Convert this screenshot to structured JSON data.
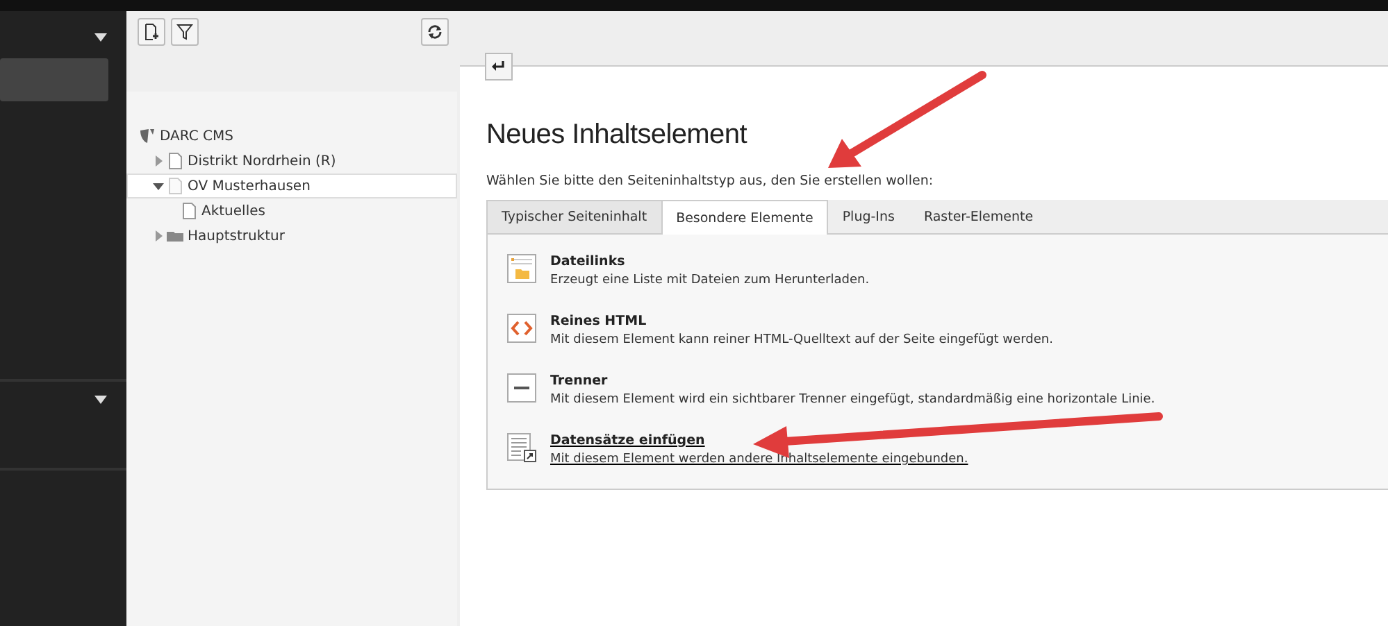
{
  "sidebar": {
    "items": [
      {
        "kind": "active"
      },
      {
        "kind": "section"
      }
    ]
  },
  "tree_toolbar": {
    "buttons": [
      {
        "kind": "new-page"
      },
      {
        "kind": "filter"
      }
    ],
    "refresh": {
      "kind": "refresh"
    }
  },
  "tree": [
    {
      "label": "DARC CMS",
      "kind": "root",
      "selected": false,
      "children": [
        {
          "label": "Distrikt Nordrhein (R)",
          "kind": "page",
          "expanded": false,
          "selected": false
        },
        {
          "label": "OV Musterhausen",
          "kind": "page-hidden",
          "expanded": true,
          "selected": true,
          "children": [
            {
              "label": "Aktuelles",
              "kind": "page",
              "selected": false
            }
          ]
        },
        {
          "label": "Hauptstruktur",
          "kind": "folder",
          "expanded": false,
          "selected": false
        }
      ]
    }
  ],
  "heading": "Neues Inhaltselement",
  "intro": "Wählen Sie bitte den Seiteninhaltstyp aus, den Sie erstellen wollen:",
  "tabs": [
    {
      "label": "Typischer Seiteninhalt",
      "selected": false
    },
    {
      "label": "Besondere Elemente",
      "selected": true
    },
    {
      "label": "Plug-Ins",
      "selected": false
    },
    {
      "label": "Raster-Elemente",
      "selected": false
    }
  ],
  "elements": [
    {
      "kind": "files",
      "title": "Dateilinks",
      "description": "Erzeugt eine Liste mit Dateien zum Herunterladen.",
      "hovered": false
    },
    {
      "kind": "html",
      "title": "Reines HTML",
      "description": "Mit diesem Element kann reiner HTML-Quelltext auf der Seite eingefügt werden.",
      "hovered": false
    },
    {
      "kind": "divider",
      "title": "Trenner",
      "description": "Mit diesem Element wird ein sichtbarer Trenner eingefügt, standardmäßig eine horizontale Linie.",
      "hovered": false
    },
    {
      "kind": "records",
      "title": "Datensätze einfügen",
      "description": "Mit diesem Element werden andere Inhaltselemente eingebunden.",
      "hovered": true
    }
  ]
}
